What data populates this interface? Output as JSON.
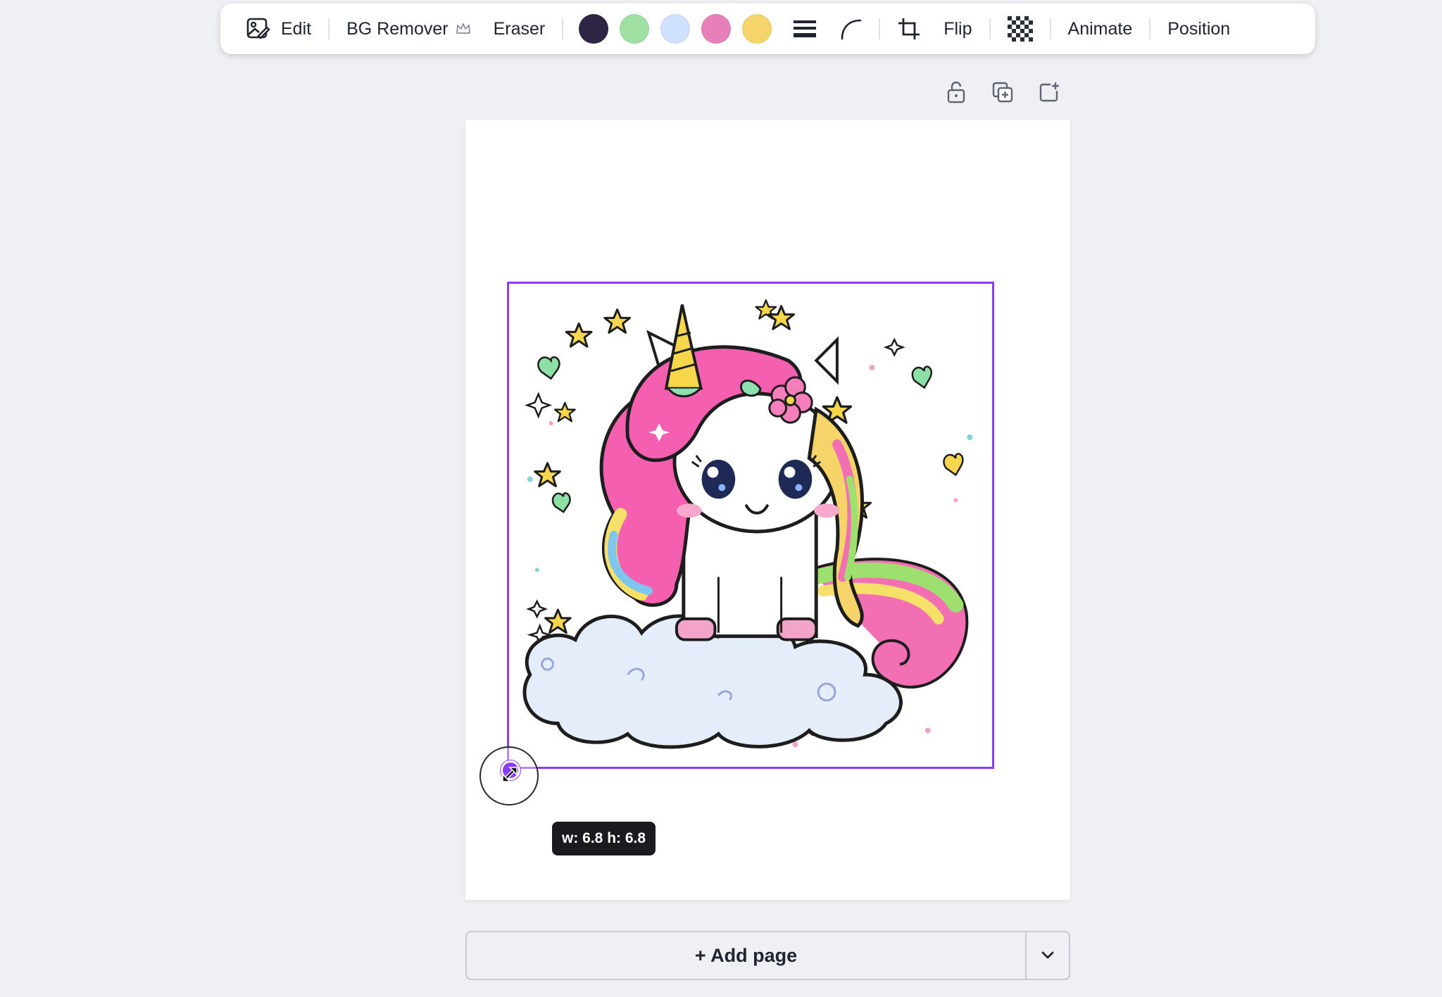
{
  "toolbar": {
    "edit_label": "Edit",
    "bg_remover_label": "BG Remover",
    "eraser_label": "Eraser",
    "flip_label": "Flip",
    "animate_label": "Animate",
    "position_label": "Position",
    "swatches": [
      "#2e2444",
      "#9fe0a2",
      "#cfe1ff",
      "#e77fb8",
      "#f5d56a"
    ]
  },
  "selection": {
    "size_label": "w: 6.8 h: 6.8"
  },
  "add_page": {
    "label": "+ Add page"
  },
  "colors": {
    "accent": "#8b3dff"
  }
}
